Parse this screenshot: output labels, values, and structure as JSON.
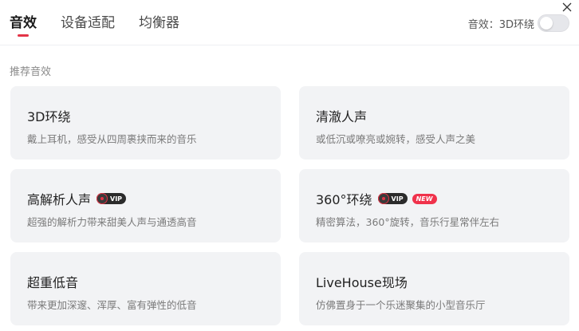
{
  "tabs": [
    {
      "label": "音效",
      "active": true
    },
    {
      "label": "设备适配",
      "active": false
    },
    {
      "label": "均衡器",
      "active": false
    }
  ],
  "effect_toggle": {
    "label": "音效：3D环绕",
    "enabled": false
  },
  "section_title": "推荐音效",
  "badges": {
    "vip": "VIP",
    "new": "NEW"
  },
  "cards": [
    {
      "title": "3D环绕",
      "desc": "戴上耳机，感受从四周裹挟而来的音乐"
    },
    {
      "title": "清澈人声",
      "desc": "或低沉或嘹亮或婉转，感受人声之美"
    },
    {
      "title": "高解析人声",
      "desc": "超强的解析力带来甜美人声与通透高音"
    },
    {
      "title": "360°环绕",
      "desc": "精密算法，360°旋转，音乐行星常伴左右"
    },
    {
      "title": "超重低音",
      "desc": "带来更加深邃、浑厚、富有弹性的低音"
    },
    {
      "title": "LiveHouse现场",
      "desc": "仿佛置身于一个乐迷聚集的小型音乐厅"
    }
  ],
  "colors": {
    "accent": "#e33447",
    "card_bg": "#f2f3f5",
    "new_badge": "#f0324b"
  }
}
